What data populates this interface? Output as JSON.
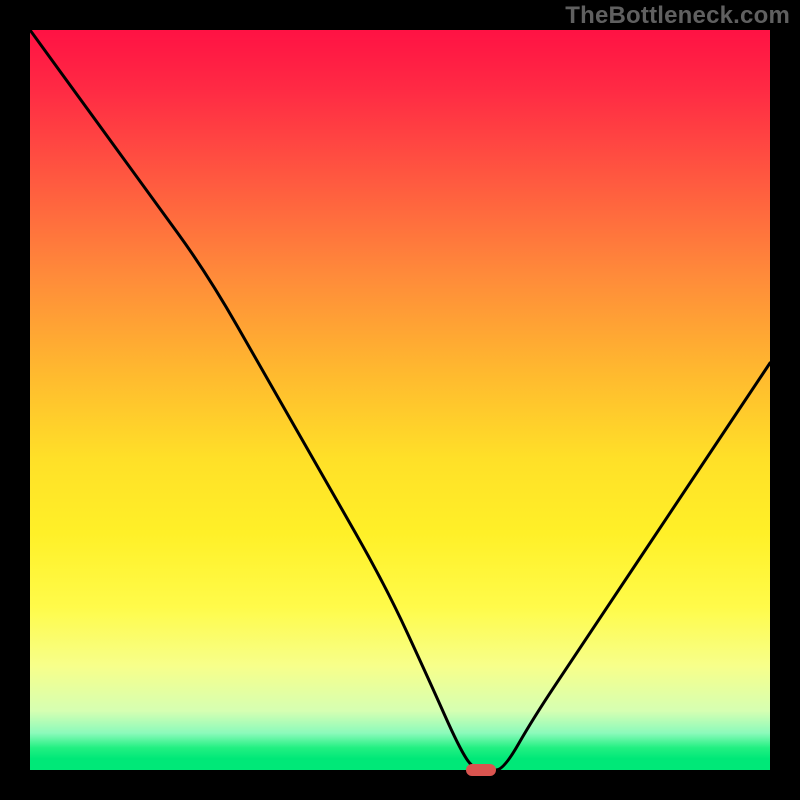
{
  "watermark": "TheBottleneck.com",
  "chart_data": {
    "type": "line",
    "title": "",
    "xlabel": "",
    "ylabel": "",
    "xlim": [
      0,
      100
    ],
    "ylim": [
      0,
      100
    ],
    "grid": false,
    "legend": false,
    "series": [
      {
        "name": "bottleneck-curve",
        "x": [
          0,
          8,
          16,
          24,
          32,
          40,
          48,
          54,
          58,
          60,
          62,
          64,
          68,
          74,
          82,
          90,
          100
        ],
        "values": [
          100,
          89,
          78,
          67,
          53,
          39,
          25,
          12,
          3,
          0,
          0,
          0,
          7,
          16,
          28,
          40,
          55
        ]
      }
    ],
    "marker": {
      "x": 61,
      "y": 0
    },
    "gradient_stops": [
      {
        "pos": 0,
        "color": "#ff1244"
      },
      {
        "pos": 0.2,
        "color": "#ff5840"
      },
      {
        "pos": 0.46,
        "color": "#ffb82f"
      },
      {
        "pos": 0.68,
        "color": "#fff028"
      },
      {
        "pos": 0.92,
        "color": "#d6ffb2"
      },
      {
        "pos": 1.0,
        "color": "#00e878"
      }
    ]
  }
}
